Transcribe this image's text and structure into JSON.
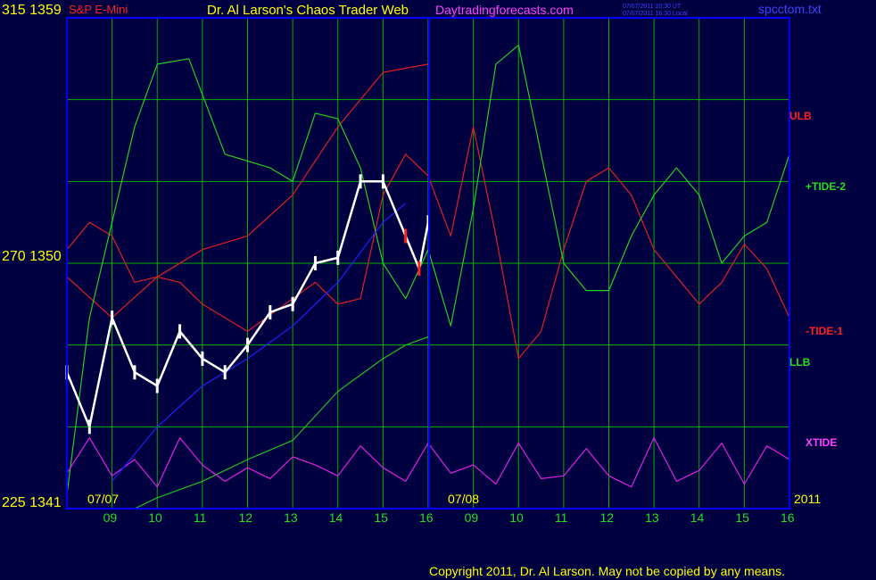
{
  "header": {
    "left_axis_top": "315 1359",
    "symbol": "S&P E-Mini",
    "title": "Dr. Al Larson's Chaos Trader Web",
    "site": "Daytradingforecasts.com",
    "stamp_ut": "07/07/2011 20:30 UT",
    "stamp_local": "07/07/2011 16:30 Local",
    "file": "spcctom.txt"
  },
  "axis": {
    "left_mid": "270 1350",
    "left_bottom": "225 1341",
    "date_start": "07/07",
    "date_mid": "07/08",
    "year": "2011",
    "hour_ticks": [
      "09",
      "10",
      "11",
      "12",
      "13",
      "14",
      "15",
      "16",
      "09",
      "10",
      "11",
      "12",
      "13",
      "14",
      "15",
      "16"
    ]
  },
  "legend": {
    "ulb": "ULB",
    "tide2": "+TIDE-2",
    "tide1": "-TIDE-1",
    "llb": "LLB",
    "xtide": "XTIDE"
  },
  "footer": {
    "copyright": "Copyright 2011, Dr. Al Larson. May not be copied by any means."
  },
  "colors": {
    "background": "#000040",
    "grid": "#00b000",
    "frame": "#0000ff",
    "ulb": "#e02020",
    "llb": "#20c020",
    "tide2": "#20d020",
    "tide1": "#e02020",
    "xtide": "#e020e0",
    "price_up": "#ffffff",
    "price_down": "#ff2020",
    "moving_avg": "#2020ff"
  },
  "chart_data": {
    "type": "line",
    "title": "S&P E-Mini",
    "ylim_price": [
      1341,
      1359
    ],
    "ylim_index": [
      225,
      315
    ],
    "x_hours": [
      9,
      10,
      11,
      12,
      13,
      14,
      15,
      16,
      9,
      10,
      11,
      12,
      13,
      14,
      15,
      16
    ],
    "series": [
      {
        "name": "ULB",
        "x": [
          8,
          9,
          10,
          11,
          12,
          13,
          14,
          15,
          16
        ],
        "values": [
          1349.5,
          1348,
          1349.5,
          1350.5,
          1351,
          1352.5,
          1355,
          1357,
          1357.3
        ]
      },
      {
        "name": "LLB",
        "x": [
          9.5,
          10,
          11,
          12,
          13,
          14,
          15,
          15.5,
          16
        ],
        "values": [
          1341,
          1341.4,
          1342,
          1342.8,
          1343.5,
          1345.3,
          1346.5,
          1347,
          1347.3
        ]
      },
      {
        "name": "+TIDE-2",
        "x": [
          8,
          8.5,
          9,
          9.5,
          10,
          10.7,
          11.5,
          12.5,
          13,
          13.5,
          14,
          14.5,
          15,
          15.5,
          16,
          16.5,
          17,
          17.5,
          18,
          18.5,
          19,
          19.5,
          20,
          20.5,
          21,
          21.5,
          22,
          22.5,
          23,
          23.5,
          24
        ],
        "values": [
          1341.5,
          1348,
          1351.5,
          1355,
          1357.3,
          1357.5,
          1354,
          1353.5,
          1353,
          1355.5,
          1355.3,
          1353.5,
          1350,
          1348.7,
          1350.5,
          1347.7,
          1352,
          1357.3,
          1358,
          1354,
          1350,
          1349,
          1349,
          1351,
          1352.5,
          1353.5,
          1352.5,
          1350,
          1351,
          1351.5,
          1354
        ]
      },
      {
        "name": "-TIDE-1",
        "x": [
          8,
          8.5,
          9,
          9.5,
          10,
          10.5,
          11,
          12,
          13,
          13.5,
          14,
          14.5,
          15,
          15.5,
          16,
          16.5,
          17,
          17.5,
          18,
          18.5,
          19,
          19.5,
          20,
          20.5,
          21,
          21.5,
          22,
          22.5,
          23,
          23.5,
          24
        ],
        "values": [
          1350.5,
          1351.5,
          1351,
          1349.3,
          1349.5,
          1349.3,
          1348.5,
          1347.5,
          1348.7,
          1349.3,
          1348.5,
          1348.7,
          1352.5,
          1354,
          1353.2,
          1351,
          1355,
          1351,
          1346.5,
          1347.5,
          1350.5,
          1353,
          1353.5,
          1352.5,
          1350.5,
          1349.5,
          1348.5,
          1349.3,
          1350.7,
          1349.8,
          1348
        ]
      },
      {
        "name": "Price",
        "x": [
          8,
          8.5,
          9,
          9.5,
          10,
          10.5,
          11,
          11.5,
          12,
          12.5,
          13,
          13.5,
          14,
          14.5,
          15,
          15.5,
          15.8,
          16
        ],
        "values": [
          1346,
          1344,
          1348,
          1346,
          1345.5,
          1347.5,
          1346.5,
          1346,
          1347,
          1348.2,
          1348.5,
          1350,
          1350.2,
          1353,
          1353,
          1351,
          1349.8,
          1351.5
        ]
      },
      {
        "name": "Average",
        "x": [
          9,
          10,
          11,
          12,
          13,
          14,
          15,
          15.5
        ],
        "values": [
          1342,
          1344,
          1345.5,
          1346.5,
          1347.7,
          1349.3,
          1351.5,
          1352.2
        ]
      },
      {
        "name": "XTIDE",
        "x": [
          8,
          8.5,
          9,
          9.5,
          10,
          10.5,
          11,
          11.5,
          12,
          12.5,
          13,
          13.5,
          14,
          14.5,
          15,
          15.5,
          16,
          16.5,
          17,
          17.5,
          18,
          18.5,
          19,
          19.5,
          20,
          20.5,
          21,
          21.5,
          22,
          22.5,
          23,
          23.5,
          24
        ],
        "values": [
          1342.3,
          1343.6,
          1342.2,
          1342.8,
          1341.8,
          1343.6,
          1342.6,
          1342,
          1342.5,
          1342.1,
          1342.9,
          1342.6,
          1342.2,
          1343.3,
          1342.5,
          1342,
          1343.4,
          1342.3,
          1342.6,
          1341.9,
          1343.4,
          1342.1,
          1342.2,
          1343.2,
          1342.2,
          1341.8,
          1343.6,
          1342,
          1342.4,
          1343.4,
          1341.9,
          1343.3,
          1342.8
        ]
      }
    ]
  }
}
